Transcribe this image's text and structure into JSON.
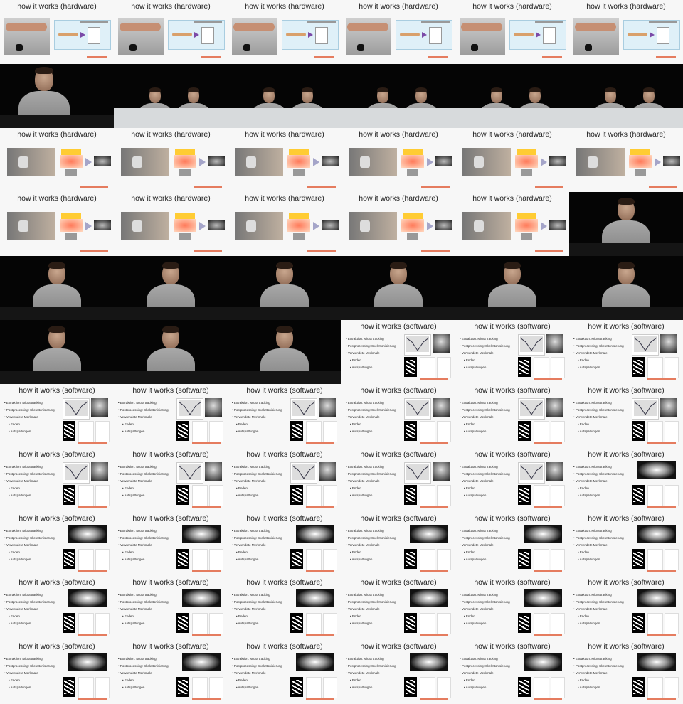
{
  "slides": {
    "hardware_title": "how it works (hardware)",
    "software_title": "how it works (software)",
    "software_bullets": [
      "Extraktion: Miura tracking",
      "Postprocessing: Skelettonisierung",
      "Verwendete Merkmale",
      "Enden",
      "Aufspaltungen"
    ]
  },
  "frames": [
    "hwA",
    "hwA",
    "hwA",
    "hwA",
    "hwA",
    "hwA",
    "cam1",
    "cam2",
    "cam2",
    "cam2",
    "cam2",
    "cam2",
    "hwB",
    "hwB",
    "hwB",
    "hwB",
    "hwB",
    "hwB",
    "hwB",
    "hwB",
    "hwB",
    "hwB",
    "hwB",
    "cam3",
    "cam3",
    "cam3",
    "cam3",
    "cam3",
    "cam3",
    "cam3",
    "cam3",
    "cam3",
    "cam3",
    "sw1",
    "sw1",
    "sw1",
    "sw1",
    "sw1",
    "sw1",
    "sw1",
    "sw1",
    "sw1",
    "sw1",
    "sw1",
    "sw1",
    "sw1",
    "sw1",
    "sw2",
    "sw2",
    "sw2",
    "sw2",
    "sw2",
    "sw2",
    "sw2",
    "sw2",
    "sw2",
    "sw2",
    "sw2",
    "sw2",
    "sw2",
    "sw2",
    "sw2",
    "sw2",
    "sw2",
    "sw2",
    "sw2"
  ]
}
